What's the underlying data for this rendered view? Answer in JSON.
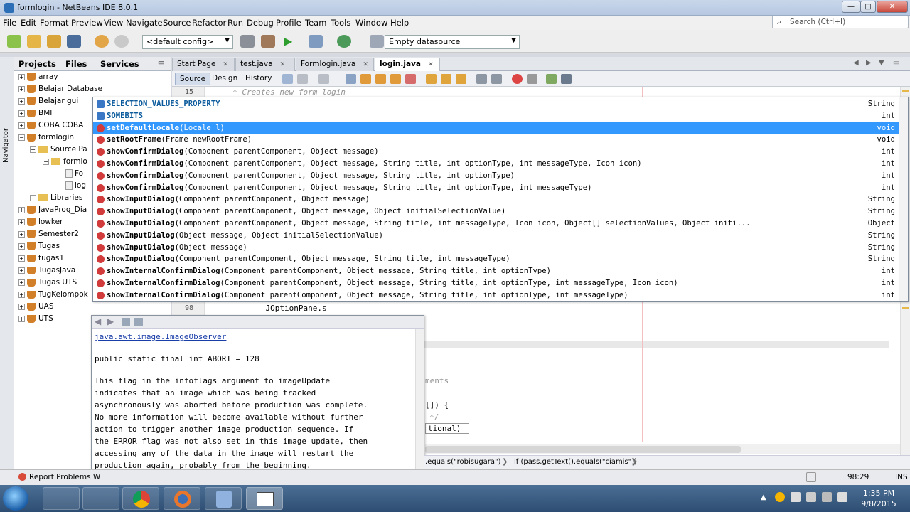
{
  "window": {
    "title": "formlogin - NetBeans IDE 8.0.1",
    "minimize": "—",
    "maximize": "□",
    "close": "✕"
  },
  "menu": [
    "File",
    "Edit",
    "Format",
    "Preview",
    "View",
    "Navigate",
    "Source",
    "Refactor",
    "Run",
    "Debug",
    "Profile",
    "Team",
    "Tools",
    "Window",
    "Help"
  ],
  "search": {
    "placeholder": "Search (Ctrl+I)"
  },
  "toolbar": {
    "config": "<default config>",
    "datasource": "Empty datasource"
  },
  "left_panel": {
    "tabs": [
      "Projects",
      "Files",
      "Services"
    ],
    "navigator": "Navigator",
    "tree": [
      "array",
      "Belajar Database",
      "Belajar gui",
      "BMI",
      "COBA COBA",
      "formlogin",
      "Source Pa",
      "formlo",
      "Fo",
      "log",
      "Libraries",
      "JavaProg_Dia",
      "lowker",
      "Semester2",
      "Tugas",
      "tugas1",
      "TugasJava",
      "Tugas UTS",
      "TugKelompok",
      "UAS",
      "UTS"
    ]
  },
  "editor_tabs": [
    {
      "label": "Start Page",
      "active": false
    },
    {
      "label": "test.java",
      "active": false
    },
    {
      "label": "Formlogin.java",
      "active": false
    },
    {
      "label": "login.java",
      "active": true
    }
  ],
  "editor_views": [
    "Source",
    "Design",
    "History"
  ],
  "code": {
    "line15_num": "15",
    "line15_text": "     * Creates new form login",
    "line98_num": "98",
    "line98_text": "            JOptionPane.s",
    "fragment_comments": "ments",
    "fragment_brace": "[]) {",
    "fragment_comment_end": "*/",
    "fragment_optional": "tional)"
  },
  "completion": [
    {
      "name": "SELECTION_VALUES_PROPERTY",
      "params": "",
      "ret": "String",
      "kind": "field",
      "selected": false
    },
    {
      "name": "SOMEBITS",
      "params": "",
      "ret": "int",
      "kind": "field",
      "selected": false
    },
    {
      "name": "setDefaultLocale",
      "params": "(Locale l)",
      "ret": "void",
      "kind": "method",
      "selected": true
    },
    {
      "name": "setRootFrame",
      "params": "(Frame newRootFrame)",
      "ret": "void",
      "kind": "method",
      "selected": false
    },
    {
      "name": "showConfirmDialog",
      "params": "(Component parentComponent, Object message)",
      "ret": "int",
      "kind": "method",
      "selected": false
    },
    {
      "name": "showConfirmDialog",
      "params": "(Component parentComponent, Object message, String title, int optionType, int messageType, Icon icon)",
      "ret": "int",
      "kind": "method",
      "selected": false
    },
    {
      "name": "showConfirmDialog",
      "params": "(Component parentComponent, Object message, String title, int optionType)",
      "ret": "int",
      "kind": "method",
      "selected": false
    },
    {
      "name": "showConfirmDialog",
      "params": "(Component parentComponent, Object message, String title, int optionType, int messageType)",
      "ret": "int",
      "kind": "method",
      "selected": false
    },
    {
      "name": "showInputDialog",
      "params": "(Component parentComponent, Object message)",
      "ret": "String",
      "kind": "method",
      "selected": false
    },
    {
      "name": "showInputDialog",
      "params": "(Component parentComponent, Object message, Object initialSelectionValue)",
      "ret": "String",
      "kind": "method",
      "selected": false
    },
    {
      "name": "showInputDialog",
      "params": "(Component parentComponent, Object message, String title, int messageType, Icon icon, Object[] selectionValues, Object initi...",
      "ret": "Object",
      "kind": "method",
      "selected": false
    },
    {
      "name": "showInputDialog",
      "params": "(Object message, Object initialSelectionValue)",
      "ret": "String",
      "kind": "method",
      "selected": false
    },
    {
      "name": "showInputDialog",
      "params": "(Object message)",
      "ret": "String",
      "kind": "method",
      "selected": false
    },
    {
      "name": "showInputDialog",
      "params": "(Component parentComponent, Object message, String title, int messageType)",
      "ret": "String",
      "kind": "method",
      "selected": false
    },
    {
      "name": "showInternalConfirmDialog",
      "params": "(Component parentComponent, Object message, String title, int optionType)",
      "ret": "int",
      "kind": "method",
      "selected": false
    },
    {
      "name": "showInternalConfirmDialog",
      "params": "(Component parentComponent, Object message, String title, int optionType, int messageType, Icon icon)",
      "ret": "int",
      "kind": "method",
      "selected": false
    },
    {
      "name": "showInternalConfirmDialog",
      "params": "(Component parentComponent, Object message, String title, int optionType, int messageType)",
      "ret": "int",
      "kind": "method",
      "selected": false
    }
  ],
  "javadoc": {
    "link": "java.awt.image.ImageObserver",
    "signature": "public static final int ABORT = 128",
    "body": [
      "This flag in the infoflags argument to imageUpdate",
      "indicates that an image which was being tracked",
      "asynchronously was aborted before production was complete.",
      "No more information will become available without further",
      "action to trigger another image production sequence. If",
      "the ERROR flag was not also set in this image update, then",
      "accessing any of the data in the image will restart the",
      "production again, probably from the beginning."
    ]
  },
  "breadcrumb": [
    ".equals(\"robisugara\")",
    "if (pass.getText().equals(\"ciamis\"))"
  ],
  "status": {
    "report": "Report Problems W",
    "position": "98:29",
    "mode": "INS"
  },
  "taskbar": {
    "time": "1:35 PM",
    "date": "9/8/2015"
  }
}
